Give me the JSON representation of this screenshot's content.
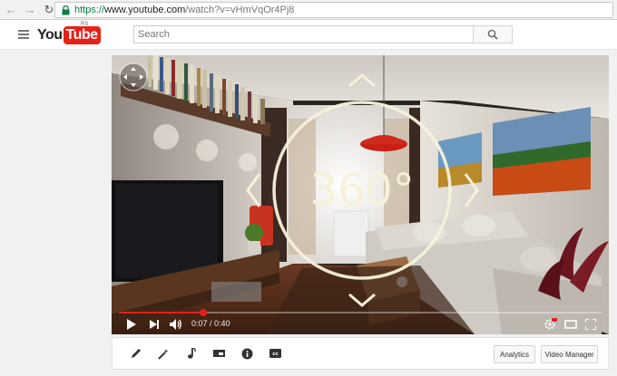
{
  "browser": {
    "url_scheme": "https://",
    "url_host": "www.youtube.com",
    "url_path": "/watch?v=vHmVqOr4Pj8"
  },
  "header": {
    "logo_you": "You",
    "logo_tube": "Tube",
    "country_code": "RS",
    "search_placeholder": "Search"
  },
  "player": {
    "overlay_text": "360°",
    "time_current": "0:07",
    "time_separator": " / ",
    "time_total": "0:40",
    "progress_fraction": 0.175
  },
  "toolbar": {
    "analytics_label": "Analytics",
    "video_manager_label": "Video Manager",
    "icons": [
      "pencil-icon",
      "magic-wand-icon",
      "music-note-icon",
      "card-icon",
      "info-icon",
      "subtitles-icon"
    ]
  },
  "colors": {
    "brand_red": "#e62117",
    "progress": "#e52117"
  }
}
